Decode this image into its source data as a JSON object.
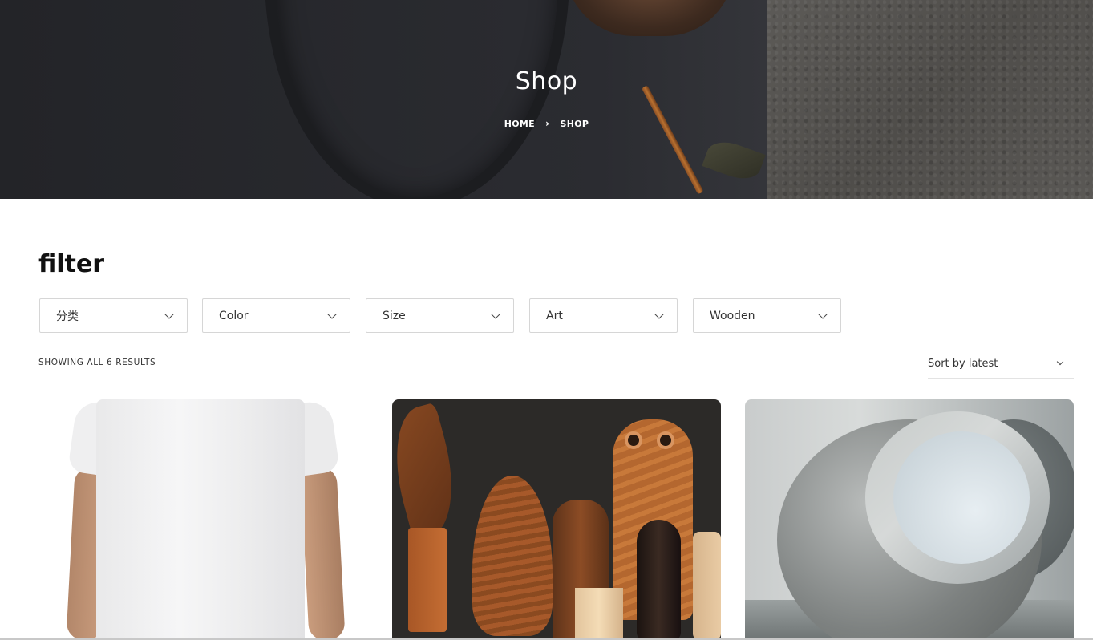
{
  "hero": {
    "title": "Shop",
    "breadcrumb": {
      "home": "HOME",
      "separator": "›",
      "current": "SHOP"
    }
  },
  "filter": {
    "title": "filter",
    "dropdowns": [
      {
        "label": "分类"
      },
      {
        "label": "Color"
      },
      {
        "label": "Size"
      },
      {
        "label": "Art"
      },
      {
        "label": "Wooden"
      }
    ]
  },
  "results": {
    "count_text": "SHOWING ALL 6 RESULTS",
    "sort_label": "Sort by latest"
  },
  "products": [
    {
      "image": "white-tshirt-photo"
    },
    {
      "image": "wooden-carvings-photo"
    },
    {
      "image": "stone-sculpture-photo"
    }
  ],
  "colors": {
    "hero_dark": "#2b2c31",
    "text_dark": "#111111",
    "border": "#d6d6d6"
  }
}
